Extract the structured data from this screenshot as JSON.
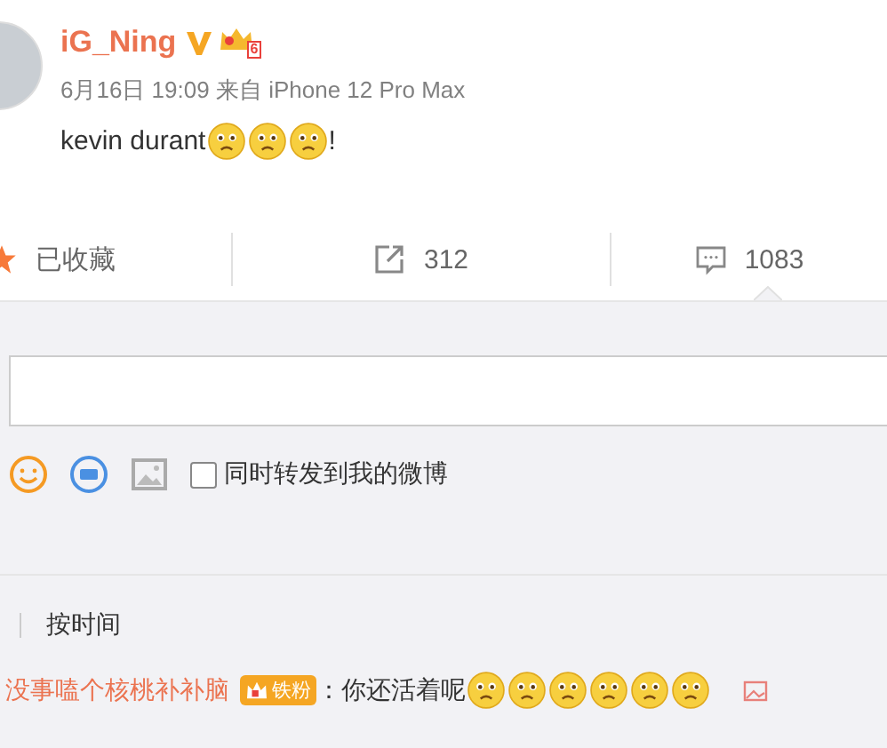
{
  "post": {
    "author": "iG_Ning",
    "verified": true,
    "level_badge": "6",
    "time": "6月16日 19:09",
    "source": "来自 iPhone 12 Pro Max",
    "content": [
      {
        "kind": "text",
        "text": "kevin durant"
      },
      {
        "kind": "emoji"
      },
      {
        "kind": "emoji"
      },
      {
        "kind": "emoji"
      },
      {
        "kind": "text",
        "text": "!"
      }
    ]
  },
  "actions": [
    {
      "kind": "favorite",
      "label": "已收藏",
      "on": true
    },
    {
      "kind": "repost",
      "label": "312"
    },
    {
      "kind": "comment",
      "label": "1083"
    }
  ],
  "composer": {
    "open": true,
    "tools": [
      {
        "kind": "emoji"
      },
      {
        "kind": "gif"
      },
      {
        "kind": "image"
      }
    ],
    "repost_checkbox": {
      "label": "同时转发到我的微博",
      "checked": false
    }
  },
  "sort": {
    "label": "按时间"
  },
  "comments": [
    {
      "user": "没事嗑个核桃补补脑",
      "badge": "铁粉",
      "content": [
        {
          "kind": "text",
          "text": "：你还活着呢"
        },
        {
          "kind": "emoji"
        },
        {
          "kind": "emoji"
        },
        {
          "kind": "emoji"
        },
        {
          "kind": "emoji"
        },
        {
          "kind": "emoji"
        },
        {
          "kind": "emoji"
        }
      ]
    }
  ]
}
